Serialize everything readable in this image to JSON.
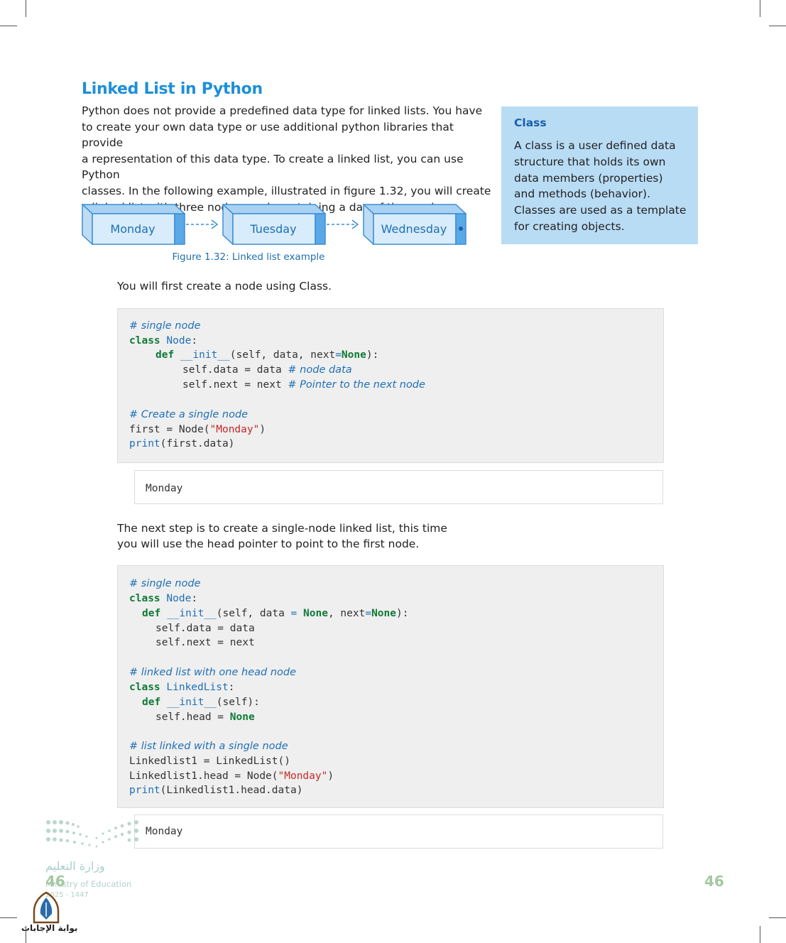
{
  "heading": "Linked List in Python",
  "intro_lines": [
    "Python does not provide a predefined data type for linked lists. You have",
    "to create your own data type or use additional python libraries that provide",
    "a representation of this data type. To create a linked list, you can use Python",
    "classes. In the following example, illustrated in figure 1.32, you will create",
    "a linked list with three nodes, each containing a day of the week."
  ],
  "sidebar": {
    "title": "Class",
    "lines": [
      "A class is a user defined data",
      "structure that holds its own",
      "data members (properties)",
      "and methods (behavior).",
      "Classes are used as a template",
      "for creating objects."
    ]
  },
  "figure": {
    "nodes": [
      "Monday",
      "Tuesday",
      "Wednesday"
    ],
    "caption": "Figure 1.32: Linked list example",
    "colors": {
      "node_fill": "#d8ecfb",
      "node_stroke": "#3d8ed6",
      "node_side": "#5aa8e6"
    }
  },
  "para1": "You will first create a node using Class.",
  "code1": {
    "c1": "# single node",
    "l2_kw": "class",
    "l2_name": "Node",
    "l2_rest": ":",
    "l3_kw": "def",
    "l3_fn": "__init__",
    "l3_a": "(self, data, next",
    "l3_eq": "=",
    "l3_none": "None",
    "l3_b": "):",
    "l4": "self.data = data",
    "l4_c": "# node data",
    "l5": "self.next = next",
    "l5_c": "# Pointer to the next node",
    "c2": "# Create a single node",
    "l7_a": "first = Node(",
    "l7_s": "\"Monday\"",
    "l7_b": ")",
    "l8_fn": "print",
    "l8_rest": "(first.data)"
  },
  "output1": "Monday",
  "para2_lines": [
    "The next step is to create a single-node linked list, this time",
    "you will use the head pointer to point to the first node."
  ],
  "code2": {
    "c1": "# single node",
    "l2_kw": "class",
    "l2_name": "Node",
    "l2_rest": ":",
    "l3_kw": "def",
    "l3_fn": "__init__",
    "l3_a": "(self, data ",
    "l3_eq": "=",
    "l3_none": "None",
    "l3_b": ", next",
    "l3_eq2": "=",
    "l3_none2": "None",
    "l3_c": "):",
    "l4": "self.data = data",
    "l5": "self.next = next",
    "c2": "# linked list with one head node",
    "l7_kw": "class",
    "l7_name": "LinkedList",
    "l7_rest": ":",
    "l8_kw": "def",
    "l8_fn": "__init__",
    "l8_rest": "(self):",
    "l9_a": "self.head = ",
    "l9_none": "None",
    "c3": "# list linked with a single node",
    "l11": "Linkedlist1 = LinkedList()",
    "l12_a": "Linkedlist1.head = Node(",
    "l12_s": "\"Monday\"",
    "l12_b": ")",
    "l13_fn": "print",
    "l13_rest": "(Linkedlist1.head.data)"
  },
  "output2": "Monday",
  "page_number": "46",
  "ministry": {
    "arabic": "وزارة التعليم",
    "english": "Ministry of Education",
    "year": "2025 - 1447"
  },
  "logo_caption": "بوابة الإجابات"
}
